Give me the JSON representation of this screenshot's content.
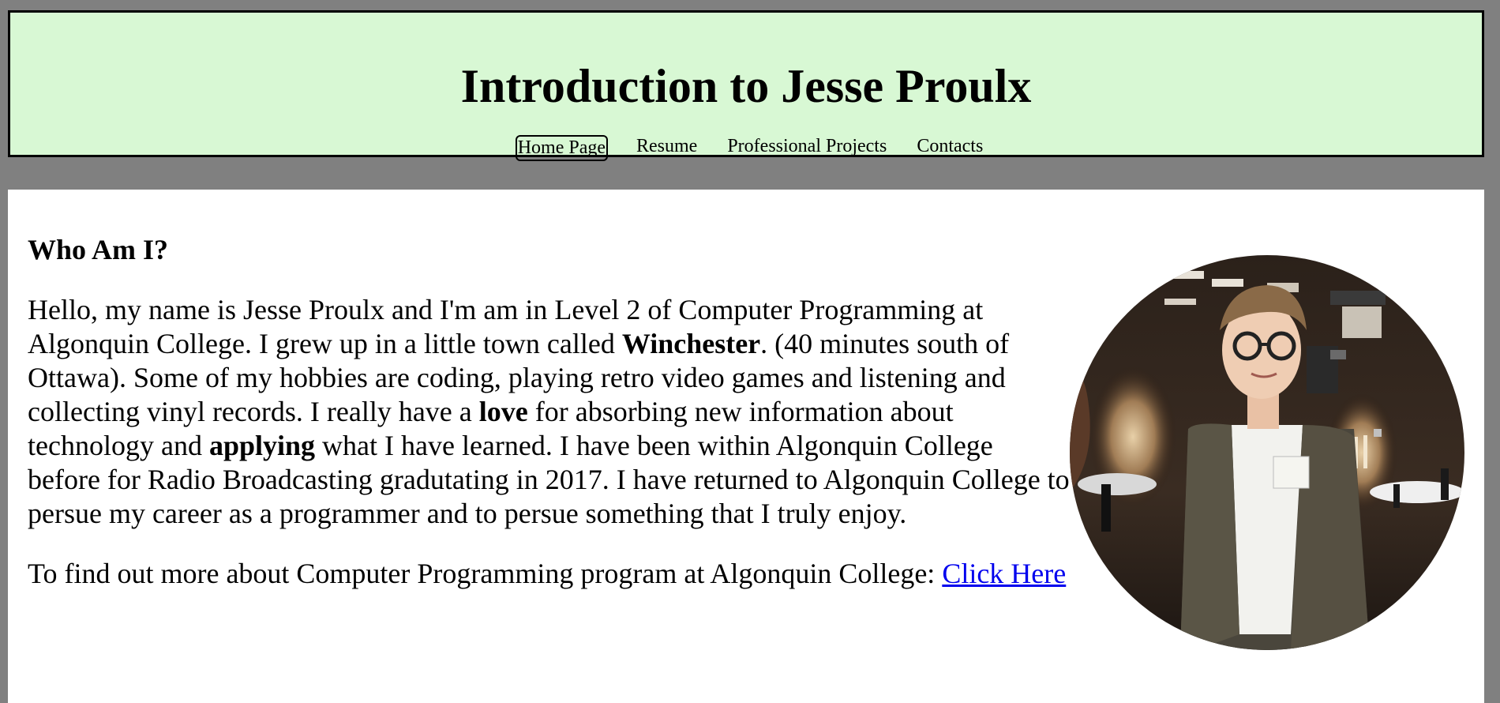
{
  "header": {
    "title": "Introduction to Jesse Proulx",
    "background_color": "#d8f8d4",
    "nav": [
      {
        "label": "Home Page",
        "active": true
      },
      {
        "label": "Resume",
        "active": false
      },
      {
        "label": "Professional Projects",
        "active": false
      },
      {
        "label": "Contacts",
        "active": false
      }
    ]
  },
  "main": {
    "heading": "Who Am I?",
    "intro": {
      "part1": "Hello, my name is Jesse Proulx and I'm am in Level 2 of Computer Programming at Algonquin College. I grew up in a little town called ",
      "bold1": "Winchester",
      "part2": ". (40 minutes south of Ottawa). Some of my hobbies are coding, playing retro video games and listening and collecting vinyl records. I really have a ",
      "bold2": "love",
      "part3": " for absorbing new information about technology and ",
      "bold3": "applying",
      "part4": " what I have learned. I have been within Algonquin College before for Radio Broadcasting gradutating in 2017. I have returned to Algonquin College to persue my career as a programmer and to persue something that I truly enjoy."
    },
    "more_info": {
      "text": "To find out more about Computer Programming program at Algonquin College: ",
      "link_label": "Click Here"
    },
    "link_color": "#0000ee"
  },
  "photo": {
    "icon": "profile-photo"
  }
}
